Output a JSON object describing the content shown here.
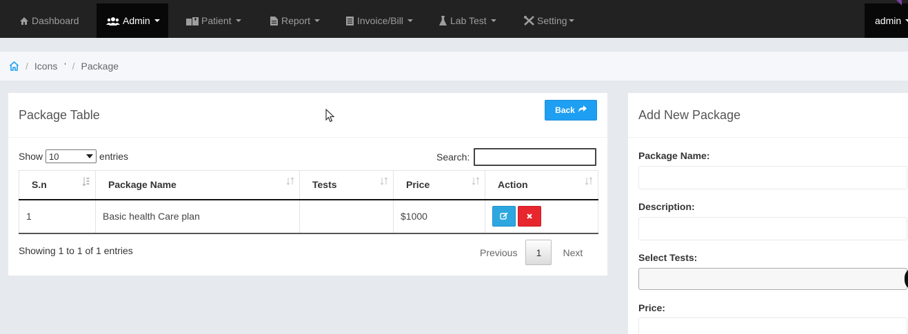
{
  "navbar": {
    "items": [
      {
        "label": "Dashboard",
        "icon": "home-icon"
      },
      {
        "label": "Admin",
        "icon": "users-icon"
      },
      {
        "label": "Patient",
        "icon": "hospital-icon"
      },
      {
        "label": "Report",
        "icon": "file-icon"
      },
      {
        "label": "Invoice/Bill",
        "icon": "invoice-icon"
      },
      {
        "label": "Lab Test",
        "icon": "flask-icon"
      },
      {
        "label": "Setting",
        "icon": "wrench-icon"
      }
    ],
    "user": "admin"
  },
  "breadcrumb": {
    "items": [
      "Icons",
      "Package"
    ],
    "tick": "'"
  },
  "package_table": {
    "title": "Package Table",
    "back_label": "Back",
    "show_label": "Show",
    "entries_label": "entries",
    "page_length": "10",
    "search_label": "Search:",
    "search_value": "",
    "columns": [
      "S.n",
      "Package Name",
      "Tests",
      "Price",
      "Action"
    ],
    "rows": [
      {
        "sn": "1",
        "name": "Basic health Care plan",
        "tests": "",
        "price": "$1000"
      }
    ],
    "info": "Showing 1 to 1 of 1 entries",
    "pagination": {
      "previous": "Previous",
      "current": "1",
      "next": "Next"
    }
  },
  "add_package": {
    "title": "Add New Package",
    "fields": {
      "name_label": "Package Name:",
      "description_label": "Description:",
      "tests_label": "Select Tests:",
      "price_label": "Price:"
    }
  },
  "colors": {
    "navbar_bg": "#222222",
    "accent_blue": "#1e9ff2",
    "danger_red": "#e8262e"
  }
}
